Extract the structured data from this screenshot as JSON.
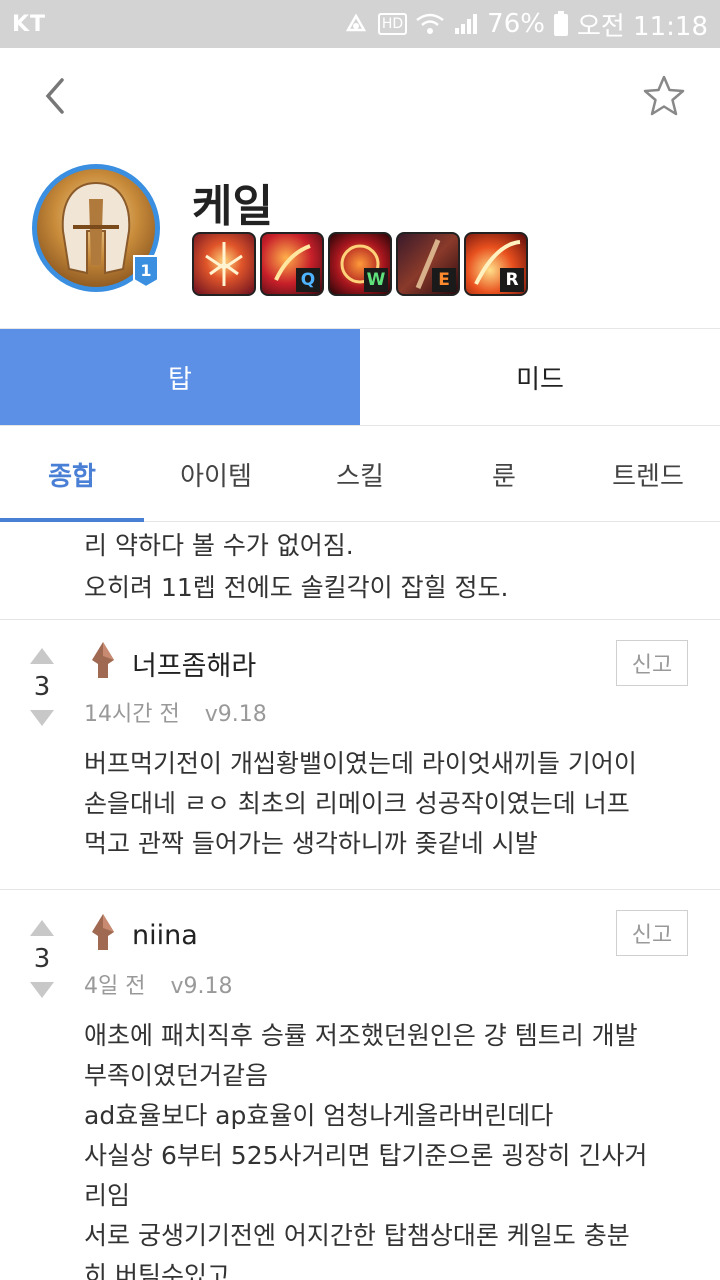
{
  "status_bar": {
    "carrier": "KT",
    "battery": "76%",
    "time": "오전 11:18",
    "hd_label": "HD"
  },
  "champion": {
    "name": "케일",
    "level_badge": "1",
    "skills": [
      {
        "key": "",
        "icon": "passive-skill-icon"
      },
      {
        "key": "Q",
        "icon": "q-skill-icon"
      },
      {
        "key": "W",
        "icon": "w-skill-icon"
      },
      {
        "key": "E",
        "icon": "e-skill-icon"
      },
      {
        "key": "R",
        "icon": "r-skill-icon"
      }
    ]
  },
  "role_tabs": [
    {
      "label": "탑",
      "active": true
    },
    {
      "label": "미드",
      "active": false
    }
  ],
  "sub_tabs": [
    {
      "label": "종합",
      "active": true
    },
    {
      "label": "아이템",
      "active": false
    },
    {
      "label": "스킬",
      "active": false
    },
    {
      "label": "룬",
      "active": false
    },
    {
      "label": "트렌드",
      "active": false
    }
  ],
  "partial_comment": {
    "lines": [
      "리 약하다 볼 수가 없어짐.",
      "오히려 11렙 전에도 솔킬각이 잡힐 정도."
    ]
  },
  "comments": [
    {
      "votes": "3",
      "author": "너프좀해라",
      "time": "14시간 전",
      "version": "v9.18",
      "report_label": "신고",
      "lines": [
        "버프먹기전이 개씹황밸이였는데 라이엇새끼들 기어이",
        "손을대네 ㄹㅇ 최초의 리메이크 성공작이였는데 너프",
        "먹고 관짝 들어가는 생각하니까 좆같네 시발"
      ]
    },
    {
      "votes": "3",
      "author": "niina",
      "time": "4일 전",
      "version": "v9.18",
      "report_label": "신고",
      "lines": [
        "애초에 패치직후 승률 저조했던원인은 걍 템트리 개발",
        "부족이였던거같음",
        "ad효율보다 ap효율이 엄청나게올라버린데다",
        "사실상 6부터 525사거리면 탑기준으론 굉장히 긴사거",
        "리임",
        "서로 궁생기기전엔 어지간한 탑챔상대론 케일도 충분",
        "히 버팀수있고"
      ]
    }
  ],
  "colors": {
    "accent": "#5c8fe6",
    "subtab_active": "#4a7fd6",
    "statusbar": "#d3d3d3",
    "avatar_border": "#3a8fe0"
  }
}
